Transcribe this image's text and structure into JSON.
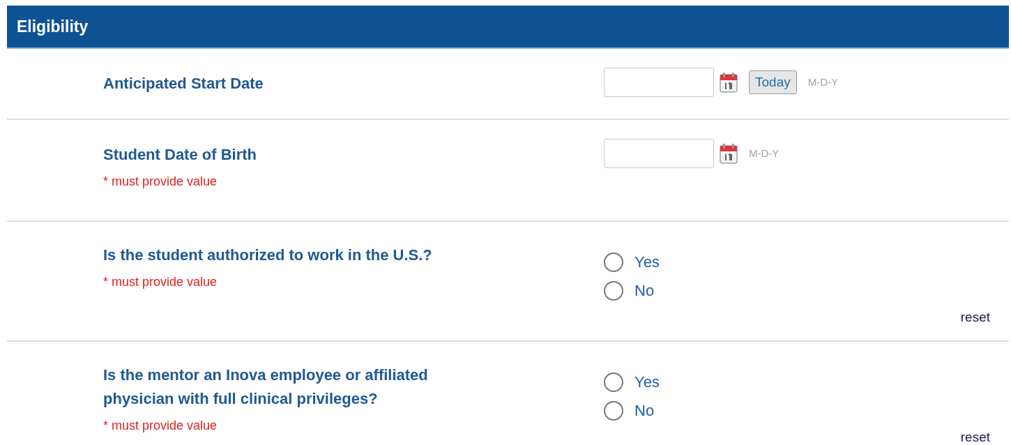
{
  "section": {
    "title": "Eligibility"
  },
  "questions": [
    {
      "kind": "date",
      "label": "Anticipated Start Date",
      "today_button": "Today",
      "format_hint": "M-D-Y"
    },
    {
      "kind": "date",
      "label": "Student Date of Birth",
      "required_note": "* must provide value",
      "format_hint": "M-D-Y"
    },
    {
      "kind": "radio",
      "label": "Is the student authorized to work in the U.S.?",
      "required_note": "* must provide value",
      "options": [
        {
          "label": "Yes",
          "selected": false
        },
        {
          "label": "No",
          "selected": false
        }
      ],
      "reset": "reset"
    },
    {
      "kind": "radio",
      "label": "Is the mentor an Inova employee or affiliated physician with full clinical privileges?",
      "required_note": "* must provide value",
      "options": [
        {
          "label": "Yes",
          "selected": false
        },
        {
          "label": "No",
          "selected": false
        }
      ],
      "reset": "reset"
    }
  ]
}
